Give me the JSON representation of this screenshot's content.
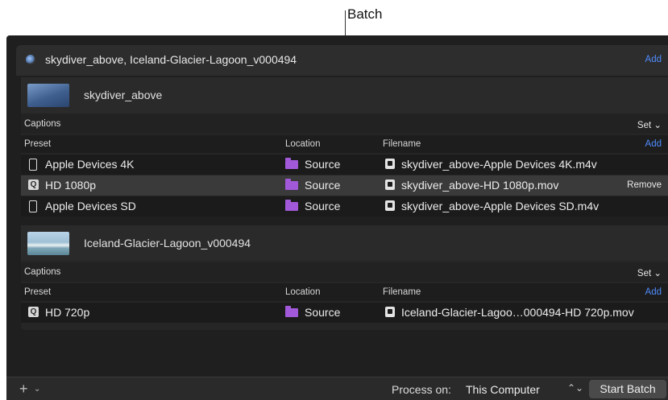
{
  "callout": {
    "label": "Batch"
  },
  "batch": {
    "title": "skydiver_above, Iceland-Glacier-Lagoon_v000494",
    "add_label": "Add"
  },
  "clips": [
    {
      "name": "skydiver_above",
      "captions_label": "Captions",
      "set_label": "Set ⌄",
      "headers": {
        "preset": "Preset",
        "location": "Location",
        "filename": "Filename",
        "add": "Add"
      },
      "rows": [
        {
          "preset": "Apple Devices 4K",
          "location": "Source",
          "filename": "skydiver_above-Apple Devices 4K.m4v"
        },
        {
          "preset": "HD 1080p",
          "location": "Source",
          "filename": "skydiver_above-HD 1080p.mov",
          "action": "Remove"
        },
        {
          "preset": "Apple Devices SD",
          "location": "Source",
          "filename": "skydiver_above-Apple Devices SD.m4v"
        }
      ]
    },
    {
      "name": "Iceland-Glacier-Lagoon_v000494",
      "captions_label": "Captions",
      "set_label": "Set ⌄",
      "headers": {
        "preset": "Preset",
        "location": "Location",
        "filename": "Filename",
        "add": "Add"
      },
      "rows": [
        {
          "preset": "HD 720p",
          "location": "Source",
          "filename": "Iceland-Glacier-Lagoo…000494-HD 720p.mov"
        }
      ]
    }
  ],
  "footer": {
    "add_glyph": "+",
    "chevron_glyph": "⌄",
    "process_label": "Process on:",
    "process_value": "This Computer",
    "updown_glyph": "⌃⌄",
    "start_label": "Start Batch"
  },
  "colors": {
    "accent": "#4f8cff",
    "folder": "#a259d9",
    "selected_row": "#3a3a3a"
  }
}
